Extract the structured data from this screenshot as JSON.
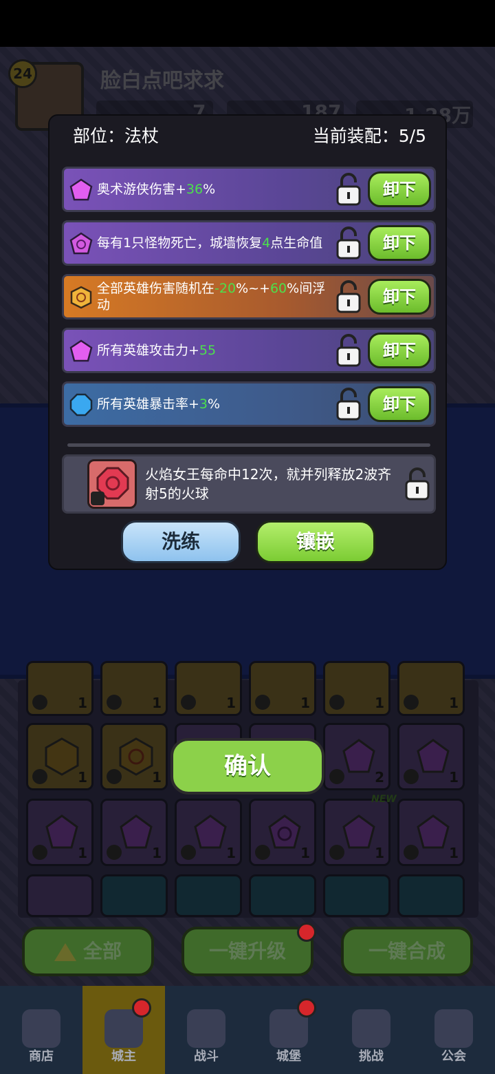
{
  "player": {
    "level": "24",
    "name": "脸白点吧求求",
    "resources": [
      "7",
      "187",
      "1.28万"
    ]
  },
  "modal": {
    "part_label": "部位：法杖",
    "equip_label": "当前装配：5/5",
    "affixes": [
      {
        "pre": "奥术游侠伤害+",
        "v1": "36",
        "mid": "%",
        "v2": "",
        "post": "",
        "color": "purple",
        "icon": "purple-pentagon-gem-icon"
      },
      {
        "pre": "每有1只怪物死亡，城墙恢复",
        "v1": "4",
        "mid": "点生命值",
        "v2": "",
        "post": "",
        "color": "purple",
        "icon": "purple-swirl-gem-icon"
      },
      {
        "pre": "全部英雄伤害随机在",
        "v1": "-20",
        "mid": "%~+",
        "v2": "60",
        "post": "%间浮动",
        "color": "orange",
        "icon": "gold-swirl-gem-icon"
      },
      {
        "pre": "所有英雄攻击力+",
        "v1": "55",
        "mid": "",
        "v2": "",
        "post": "",
        "color": "purple",
        "icon": "purple-pentagon-gem-icon"
      },
      {
        "pre": "所有英雄暴击率+",
        "v1": "3",
        "mid": "%",
        "v2": "",
        "post": "",
        "color": "blue",
        "icon": "blue-octagon-gem-icon"
      }
    ],
    "unequip_label": "卸下",
    "special_text": "火焰女王每命中12次，就并列释放2波齐射5的火球",
    "wash_label": "洗练",
    "inlay_label": "镶嵌"
  },
  "grid": {
    "row1_counts": [
      "1",
      "1",
      "1",
      "1",
      "1",
      "1"
    ],
    "row2_counts": [
      "1",
      "1",
      "",
      "",
      "2",
      "1"
    ],
    "row3_counts": [
      "1",
      "1",
      "1",
      "1",
      "1",
      "1"
    ],
    "new_badge": "NEW"
  },
  "confirm_label": "确认",
  "bottom_buttons": [
    "全部",
    "一键升级",
    "一键合成"
  ],
  "nav": [
    "商店",
    "城主",
    "战斗",
    "城堡",
    "挑战",
    "公会"
  ],
  "colors": {
    "accent_green": "#8cd14a",
    "affix_number_green": "#4ce04c",
    "affix_purple": "#7a52b8",
    "affix_orange": "#d77a24",
    "affix_blue": "#3d6ca4"
  }
}
